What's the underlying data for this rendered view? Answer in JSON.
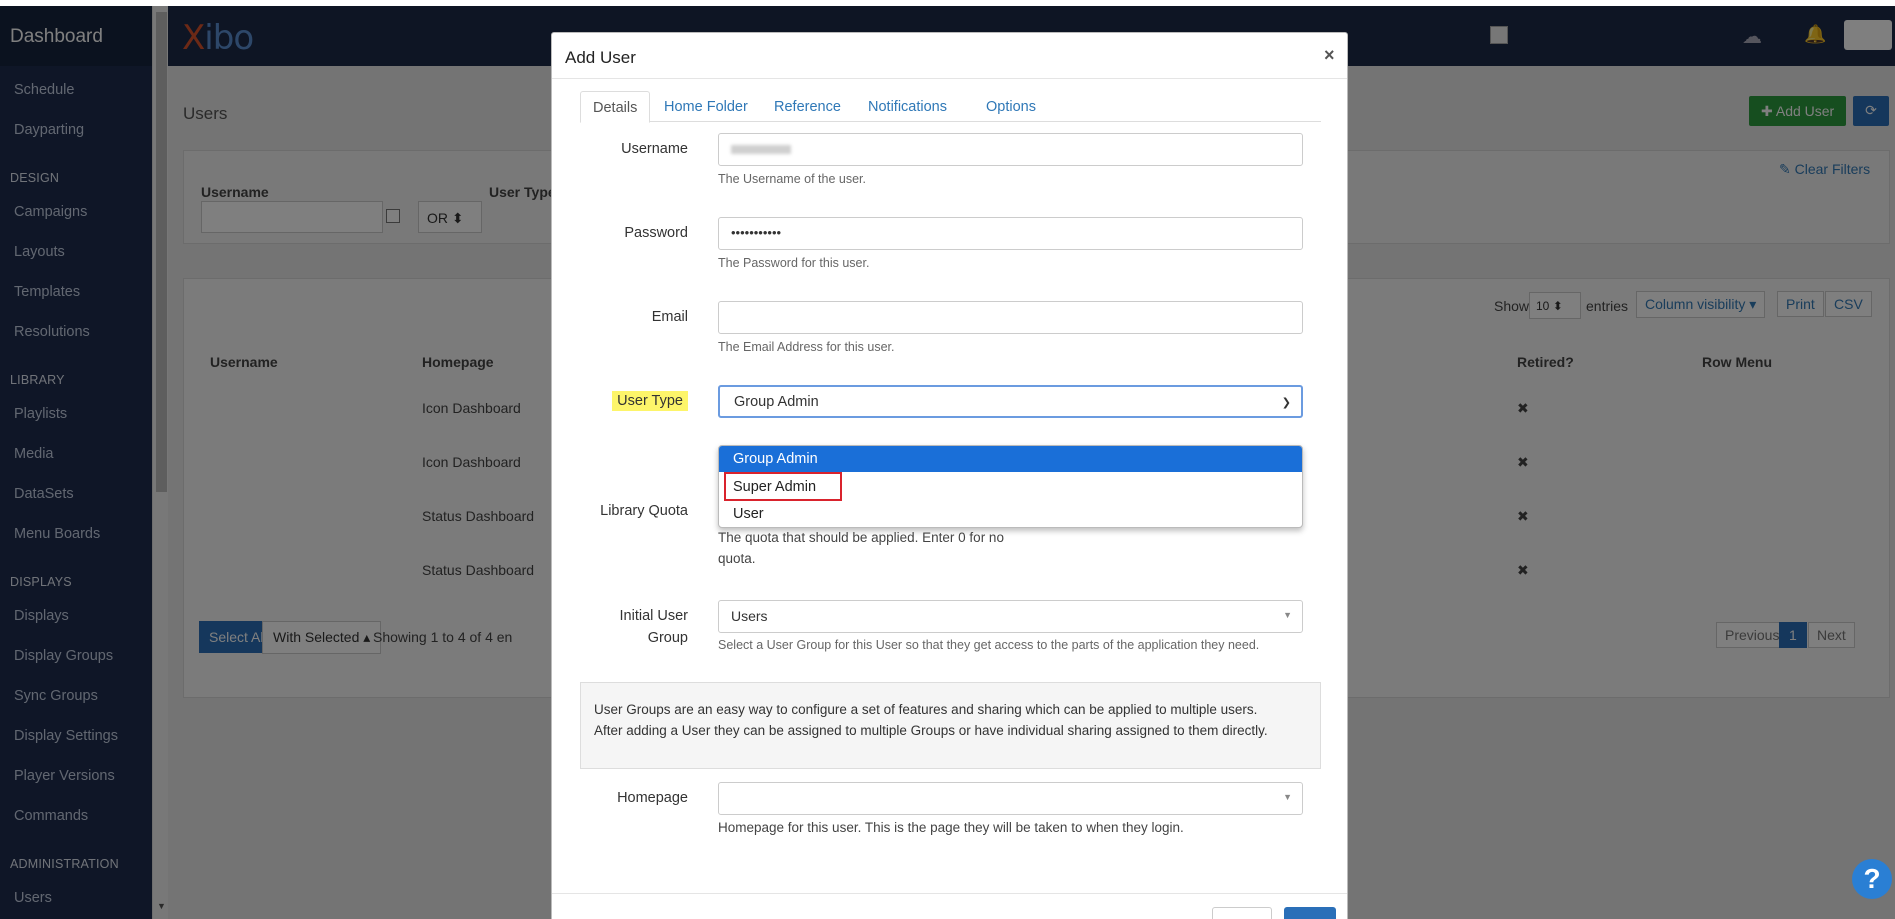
{
  "sidebar": {
    "title": "Dashboard",
    "items": [
      {
        "label": "Schedule",
        "type": "item"
      },
      {
        "label": "Dayparting",
        "type": "item"
      },
      {
        "label": "DESIGN",
        "type": "section"
      },
      {
        "label": "Campaigns",
        "type": "item"
      },
      {
        "label": "Layouts",
        "type": "item"
      },
      {
        "label": "Templates",
        "type": "item"
      },
      {
        "label": "Resolutions",
        "type": "item"
      },
      {
        "label": "LIBRARY",
        "type": "section"
      },
      {
        "label": "Playlists",
        "type": "item"
      },
      {
        "label": "Media",
        "type": "item"
      },
      {
        "label": "DataSets",
        "type": "item"
      },
      {
        "label": "Menu Boards",
        "type": "item"
      },
      {
        "label": "DISPLAYS",
        "type": "section"
      },
      {
        "label": "Displays",
        "type": "item"
      },
      {
        "label": "Display Groups",
        "type": "item"
      },
      {
        "label": "Sync Groups",
        "type": "item"
      },
      {
        "label": "Display Settings",
        "type": "item"
      },
      {
        "label": "Player Versions",
        "type": "item"
      },
      {
        "label": "Commands",
        "type": "item"
      },
      {
        "label": "ADMINISTRATION",
        "type": "section"
      },
      {
        "label": "Users",
        "type": "item"
      }
    ]
  },
  "topnav": {
    "logo_x": "X",
    "logo_rest": "ibo"
  },
  "page": {
    "title": "Users",
    "add_user": "Add User",
    "clear_filters": "Clear Filters",
    "filter_username": "Username",
    "filter_user_type": "User Type",
    "filter_or": "OR",
    "show": "Show",
    "entries_count": "10",
    "entries": "entries",
    "column_visibility": "Column visibility",
    "print": "Print",
    "csv": "CSV",
    "columns": [
      "Username",
      "Homepage",
      "Retired?",
      "Row Menu"
    ],
    "rows": [
      {
        "homepage": "Icon Dashboard",
        "retired": "✖"
      },
      {
        "homepage": "Icon Dashboard",
        "retired": "✖"
      },
      {
        "homepage": "Status Dashboard",
        "retired": "✖"
      },
      {
        "homepage": "Status Dashboard",
        "retired": "✖"
      }
    ],
    "select_all": "Select All",
    "with_selected": "With Selected",
    "showing": "Showing 1 to 4 of 4 en",
    "previous": "Previous",
    "page_num": "1",
    "next": "Next"
  },
  "modal": {
    "title": "Add User",
    "close": "×",
    "tabs": [
      "Details",
      "Home Folder",
      "Reference",
      "Notifications",
      "Options"
    ],
    "username_label": "Username",
    "username_help": "The Username of the user.",
    "password_label": "Password",
    "password_value": "•••••••••••",
    "password_help": "The Password for this user.",
    "email_label": "Email",
    "email_help": "The Email Address for this user.",
    "usertype_label": "User Type",
    "usertype_value": "Group Admin",
    "usertype_options": [
      "Group Admin",
      "Super Admin",
      "User"
    ],
    "quota_label": "Library Quota",
    "quota_help_1": "The quota that should be applied. Enter 0 for no",
    "quota_help_2": "quota.",
    "group_label_1": "Initial User",
    "group_label_2": "Group",
    "group_value": "Users",
    "group_help": "Select a User Group for this User so that they get access to the parts of the application they need.",
    "info_1": "User Groups are an easy way to configure a set of features and sharing which can be applied to multiple users.",
    "info_2": "After adding a User they can be assigned to multiple Groups or have individual sharing assigned to them directly.",
    "homepage_label": "Homepage",
    "homepage_help": "Homepage for this user. This is the page they will be taken to when they login."
  },
  "help_fab": "?"
}
